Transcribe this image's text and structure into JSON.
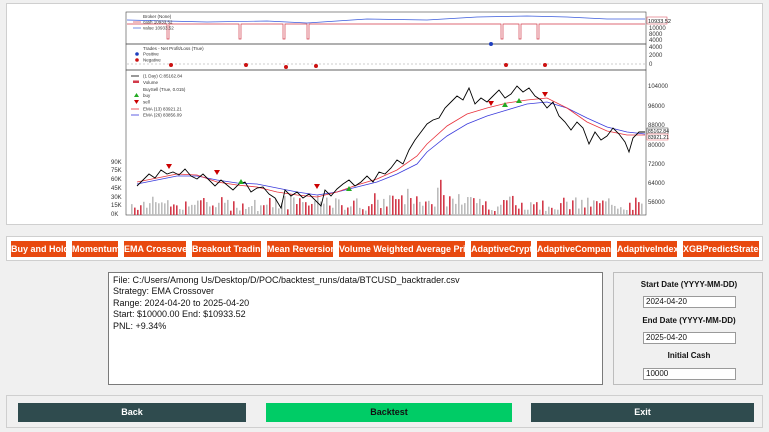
{
  "chart": {
    "broker_legend": [
      "Broker (None)",
      "cash 10933.52",
      "value 10933.52"
    ],
    "broker_axis": [
      "10000",
      "8000",
      "4000"
    ],
    "broker_last_label": "10933.52",
    "trades_legend": [
      "Trades - Net Profit/Loss (True)",
      "Positive",
      "Negative"
    ],
    "trades_axis": [
      "4000",
      "2000",
      "0"
    ],
    "price_legend": [
      "(1 Day) C:85162.84",
      "Volume",
      "BuySell (True, 0.015)",
      "buy",
      "sell",
      "EMA (13) 83921.21",
      "EMA (26) 83856.09"
    ],
    "price_axis": [
      "104000",
      "96000",
      "88000",
      "80000",
      "72000",
      "64000",
      "56000"
    ],
    "price_last_labels": [
      "85162.84",
      "83921.21"
    ],
    "volume_axis": [
      "90K",
      "75K",
      "60K",
      "45K",
      "30K",
      "15K",
      "0K"
    ],
    "colors": {
      "price": "#000000",
      "ema13": "#e8323c",
      "ema26": "#3b3bdc",
      "buy": "#22aa22",
      "sell": "#cc0000",
      "volume_up": "#bcbcbc",
      "volume_down": "#d23a4a",
      "trade_positive": "#1f3fbf",
      "trade_negative": "#cc1111"
    }
  },
  "strategies": [
    "Buy and Hold",
    "Momentum",
    "EMA Crossover",
    "Breakout Trading",
    "Mean Reversion",
    "Volume Weighted Average Price",
    "AdaptiveCrypto",
    "AdaptiveCompany",
    "AdaptiveIndex",
    "XGBPredictStrategy"
  ],
  "output": {
    "line1": "File: C:/Users/Among Us/Desktop/D/POC/backtest_runs/data/BTCUSD_backtrader.csv",
    "line2": "Strategy: EMA Crossover",
    "line3": "Range: 2024-04-20 to 2025-04-20",
    "line4": "Start: $10000.00 End: $10933.52",
    "line5": "PNL: +9.34%"
  },
  "params": {
    "start_label": "Start Date (YYYY-MM-DD)",
    "start_value": "2024-04-20",
    "end_label": "End Date (YYYY-MM-DD)",
    "end_value": "2025-04-20",
    "cash_label": "Initial Cash",
    "cash_value": "10000"
  },
  "buttons": {
    "back": "Back",
    "backtest": "Backtest",
    "exit": "Exit"
  }
}
